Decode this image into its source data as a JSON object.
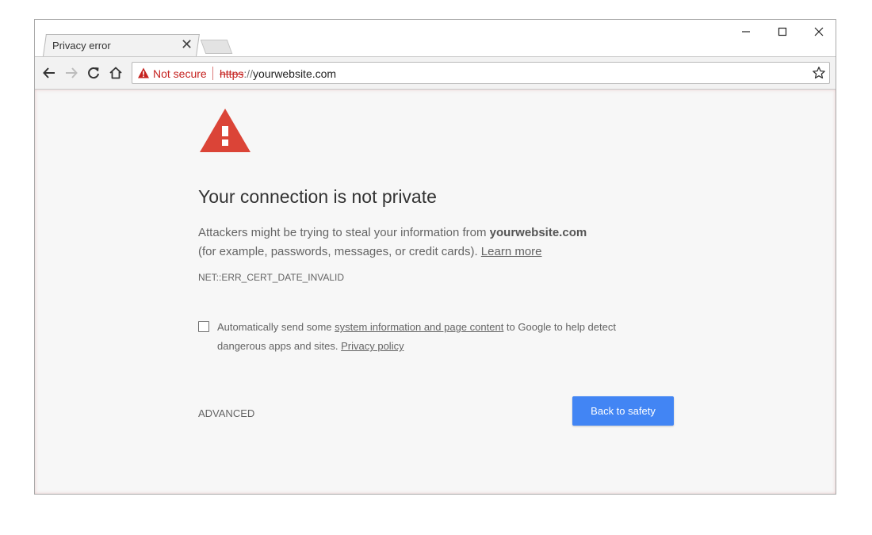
{
  "tab": {
    "title": "Privacy error",
    "close_symbol": "✕"
  },
  "window_controls": [
    "minimize-icon",
    "maximize-icon",
    "close-icon"
  ],
  "omnibox": {
    "security_label": "Not secure",
    "url_scheme": "https",
    "url_separator": "://",
    "url_host": "yourwebsite.com"
  },
  "page": {
    "heading": "Your connection is not private",
    "desc_line1_prefix": "Attackers might be trying to steal your information from ",
    "desc_host": "yourwebsite.com",
    "desc_line2": "(for example, passwords, messages, or credit cards). ",
    "learn_more": "Learn more",
    "error_code": "NET::ERR_CERT_DATE_INVALID",
    "checkbox_prefix": "Automatically send some ",
    "checkbox_link": "system information and page content",
    "checkbox_suffix": " to Google to help detect dangerous apps and sites. ",
    "privacy_link": "Privacy policy",
    "advanced": "ADVANCED",
    "back_button": "Back to safety"
  },
  "colors": {
    "accent": "#4285f4",
    "danger": "#db4437",
    "insecure": "#c5221f",
    "background": "#f7f7f7"
  }
}
